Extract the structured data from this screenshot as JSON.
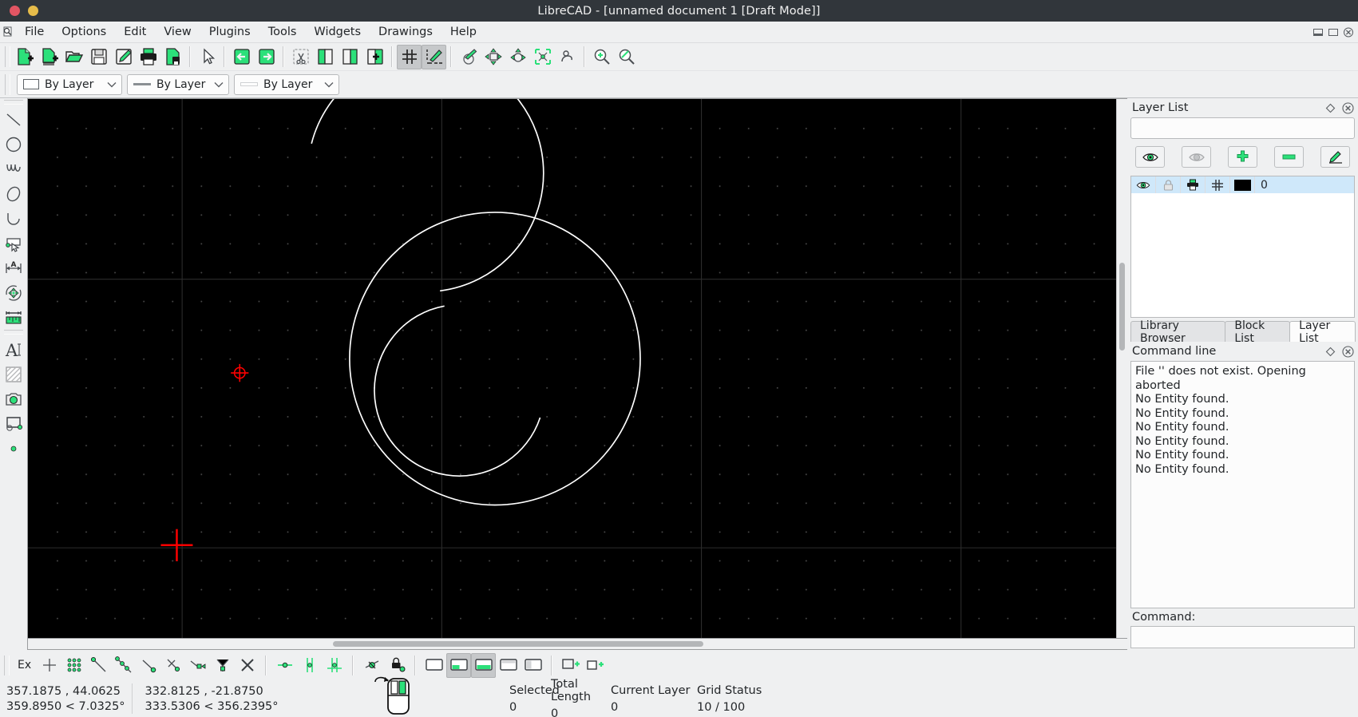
{
  "window": {
    "title": "LibreCAD - [unnamed document 1 [Draft Mode]]",
    "close_label": "",
    "minimize_label": ""
  },
  "menubar": {
    "items": [
      {
        "label": "File",
        "name": "menu-file"
      },
      {
        "label": "Options",
        "name": "menu-options"
      },
      {
        "label": "Edit",
        "name": "menu-edit"
      },
      {
        "label": "View",
        "name": "menu-view"
      },
      {
        "label": "Plugins",
        "name": "menu-plugins"
      },
      {
        "label": "Tools",
        "name": "menu-tools"
      },
      {
        "label": "Widgets",
        "name": "menu-widgets"
      },
      {
        "label": "Drawings",
        "name": "menu-drawings"
      },
      {
        "label": "Help",
        "name": "menu-help"
      }
    ]
  },
  "toolbar": {
    "items": [
      {
        "name": "new-file-icon",
        "tip": "New"
      },
      {
        "name": "new-from-template-icon",
        "tip": "New from template"
      },
      {
        "name": "open-file-icon",
        "tip": "Open"
      },
      {
        "name": "save-file-icon",
        "tip": "Save"
      },
      {
        "name": "save-as-icon",
        "tip": "Save as"
      },
      {
        "name": "print-icon",
        "tip": "Print"
      },
      {
        "name": "print-preview-icon",
        "tip": "Print preview"
      },
      {
        "name": "select-pointer-icon",
        "tip": "Select"
      },
      {
        "name": "undo-icon",
        "tip": "Undo"
      },
      {
        "name": "redo-icon",
        "tip": "Redo"
      },
      {
        "name": "cut-icon",
        "tip": "Cut"
      },
      {
        "name": "copy-icon",
        "tip": "Copy"
      },
      {
        "name": "paste-icon",
        "tip": "Paste"
      },
      {
        "name": "paste-block-icon",
        "tip": "Paste block"
      },
      {
        "name": "grid-toggle-icon",
        "tip": "Grid",
        "checked": true
      },
      {
        "name": "draft-mode-icon",
        "tip": "Draft mode",
        "checked": true
      },
      {
        "name": "redraw-icon",
        "tip": "Redraw"
      },
      {
        "name": "zoom-window-icon",
        "tip": "Zoom window"
      },
      {
        "name": "zoom-previous-icon",
        "tip": "Zoom previous"
      },
      {
        "name": "zoom-auto-icon",
        "tip": "Zoom auto"
      },
      {
        "name": "zoom-pan-icon",
        "tip": "Pan"
      },
      {
        "name": "zoom-in-icon",
        "tip": "Zoom in"
      },
      {
        "name": "zoom-out-icon",
        "tip": "Zoom out"
      }
    ]
  },
  "attributes": {
    "pen_color": {
      "label": "By Layer",
      "swatch": "#ffffff"
    },
    "pen_linetype": {
      "label": "By Layer"
    },
    "pen_width": {
      "label": "By Layer"
    }
  },
  "lefttools": {
    "items": [
      {
        "name": "tool-line-icon",
        "label": "Line"
      },
      {
        "name": "tool-circle-icon",
        "label": "Circle"
      },
      {
        "name": "tool-spline-icon",
        "label": "Spline"
      },
      {
        "name": "tool-ellipse-icon",
        "label": "Ellipse"
      },
      {
        "name": "tool-arc-icon",
        "label": "Arc"
      },
      {
        "name": "tool-select-icon",
        "label": "Select"
      },
      {
        "name": "tool-dimension-icon",
        "label": "Dimension"
      },
      {
        "name": "tool-modify-icon",
        "label": "Modify"
      },
      {
        "name": "tool-measure-icon",
        "label": "Info"
      },
      {
        "name": "tool-text-icon",
        "label": "Text"
      },
      {
        "name": "tool-hatch-icon",
        "label": "Hatch"
      },
      {
        "name": "tool-image-icon",
        "label": "Image"
      },
      {
        "name": "tool-block-icon",
        "label": "Block"
      },
      {
        "name": "tool-point-icon",
        "label": "Point"
      }
    ]
  },
  "layer_panel": {
    "title": "Layer List",
    "filter_value": "",
    "filter_placeholder": "",
    "buttons": [
      {
        "name": "show-all-layers-button",
        "icon": "eye-icon"
      },
      {
        "name": "hide-all-layers-button",
        "icon": "eye-closed-icon"
      },
      {
        "name": "add-layer-button",
        "icon": "plus-icon"
      },
      {
        "name": "remove-layer-button",
        "icon": "minus-icon"
      },
      {
        "name": "edit-layer-button",
        "icon": "edit-layer-icon"
      }
    ],
    "rows": [
      {
        "name": "0",
        "visible": true,
        "locked": false,
        "printable": true,
        "construction": false,
        "color": "#000000"
      }
    ]
  },
  "dock_tabs": [
    {
      "label": "Library Browser",
      "name": "tab-library-browser",
      "active": false
    },
    {
      "label": "Block List",
      "name": "tab-block-list",
      "active": false
    },
    {
      "label": "Layer List",
      "name": "tab-layer-list",
      "active": true
    }
  ],
  "command_panel": {
    "title": "Command line",
    "history": [
      "File '' does not exist. Opening aborted",
      "No Entity found.",
      "No Entity found.",
      "No Entity found.",
      "No Entity found.",
      "No Entity found.",
      "No Entity found."
    ],
    "prompt_label": "Command:",
    "input_value": ""
  },
  "bottom_toolbar": {
    "ex_label": "Ex",
    "items": [
      {
        "name": "snap-free-icon"
      },
      {
        "name": "snap-grid-icon"
      },
      {
        "name": "snap-endpoint-icon"
      },
      {
        "name": "snap-on-entity-icon"
      },
      {
        "name": "snap-center-icon"
      },
      {
        "name": "snap-middle-icon"
      },
      {
        "name": "snap-distance-icon"
      },
      {
        "name": "snap-intersection-icon"
      },
      {
        "name": "restrict-horizontal-icon"
      },
      {
        "name": "restrict-vertical-icon"
      },
      {
        "name": "restrict-orthogonal-icon"
      },
      {
        "name": "relative-zero-icon"
      },
      {
        "name": "lock-relative-zero-icon"
      },
      {
        "name": "status-widget-1-icon"
      },
      {
        "name": "status-widget-2-icon",
        "checked": true
      },
      {
        "name": "status-widget-3-icon",
        "checked": true
      },
      {
        "name": "status-widget-4-icon"
      },
      {
        "name": "status-widget-5-icon"
      },
      {
        "name": "fullscreen-icon"
      },
      {
        "name": "window-restore-icon"
      }
    ]
  },
  "statusbar": {
    "absolute_cartesian": "357.1875 , 44.0625",
    "absolute_polar": "359.8950 < 7.0325°",
    "relative_cartesian": "332.8125 , -21.8750",
    "relative_polar": "333.5306 < 356.2395°",
    "stats": [
      {
        "header": "Selected",
        "value": "0",
        "name": "status-selected"
      },
      {
        "header": "Total Length",
        "value": "0",
        "name": "status-total-length"
      },
      {
        "header": "Current Layer",
        "value": "0",
        "name": "status-current-layer"
      },
      {
        "header": "Grid Status",
        "value": "10 / 100",
        "name": "status-grid"
      }
    ]
  },
  "canvas": {
    "background": "#000000",
    "grid_color": "#3a3a3a",
    "entity_color": "#ffffff",
    "relative_zero_color": "#ff0000",
    "crosshair_color": "#ff0000"
  }
}
